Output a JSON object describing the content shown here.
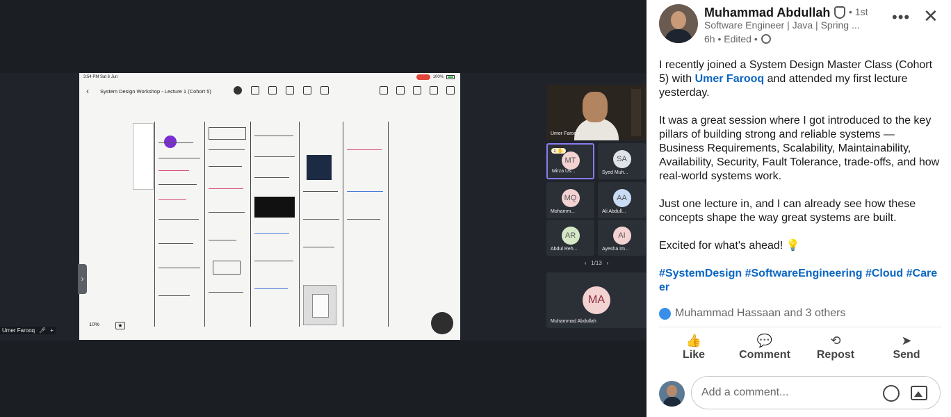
{
  "media": {
    "ipad": {
      "time": "3:54 PM  Sat 6 Jun",
      "battery": "100%",
      "title": "System Design Workshop - Lecture 1 (Cohort 5)",
      "zoom": "10%"
    },
    "self_label": "Umer Farooq",
    "presenter": {
      "name": "Umer Farooq"
    },
    "participants": [
      {
        "initials": "MT",
        "name": "Mirza Us...",
        "hand": "1 ✋"
      },
      {
        "initials": "SA",
        "name": "Syed Muh..."
      },
      {
        "initials": "MQ",
        "name": "Mohamm..."
      },
      {
        "initials": "AA",
        "name": "Ali Abdull..."
      },
      {
        "initials": "AR",
        "name": "Abdul Reh..."
      },
      {
        "initials": "AI",
        "name": "Ayesha Im..."
      }
    ],
    "pager": "1/13",
    "self_tile": {
      "initials": "MA",
      "name": "Muhammad Abdullah"
    }
  },
  "post": {
    "author": "Muhammad Abdullah",
    "degree": "• 1st",
    "headline": "Software Engineer | Java | Spring ...",
    "meta": "6h • Edited •",
    "body": {
      "p1_before": "I recently joined a System Design Master Class (Cohort 5) with ",
      "p1_mention": "Umer Farooq",
      "p1_after": " and attended my first lecture yesterday.",
      "p2": "It was a great session where I got introduced to the key pillars of building strong and reliable systems — Business Requirements, Scalability, Maintainability, Availability, Security, Fault Tolerance, trade-offs, and how real-world systems work.",
      "p3": "Just one lecture in, and I can already see how these concepts shape the way great systems are built.",
      "p4": "Excited for what's ahead! 💡",
      "hashtags": "#SystemDesign #SoftwareEngineering #Cloud #Career"
    },
    "reactions": "Muhammad Hassaan and 3 others",
    "actions": [
      {
        "label": "Like",
        "icon": "👍"
      },
      {
        "label": "Comment",
        "icon": "💬"
      },
      {
        "label": "Repost",
        "icon": "⟲"
      },
      {
        "label": "Send",
        "icon": "➤"
      }
    ],
    "comment_placeholder": "Add a comment..."
  }
}
